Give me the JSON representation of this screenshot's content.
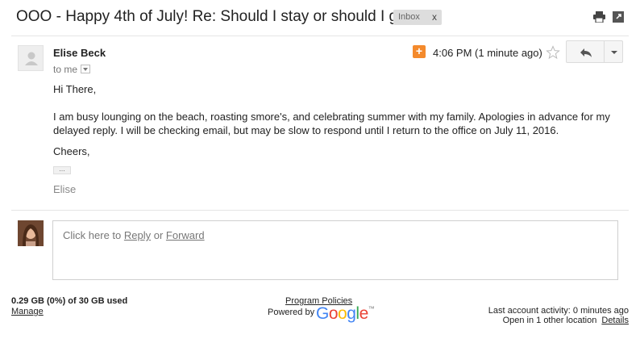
{
  "email": {
    "subject": "OOO - Happy 4th of July! Re: Should I stay or should I go?",
    "label": "Inbox",
    "label_remove": "x",
    "sender": "Elise Beck",
    "to": "to me",
    "time": "4:06 PM (1 minute ago)",
    "plus_badge": "+",
    "greeting": "Hi There,",
    "paragraph": "I am busy lounging on the beach, roasting smore's, and celebrating summer with my family. Apologies in advance for my delayed reply. I will be checking email, but may be slow to respond until I return to the office on July 11, 2016.",
    "closing": "Cheers,",
    "trimmed": "...",
    "signature": "Elise"
  },
  "reply": {
    "prefix": "Click here to ",
    "reply_link": "Reply",
    "or": " or ",
    "forward_link": "Forward"
  },
  "footer": {
    "storage": "0.29 GB (0%) of 30 GB used",
    "manage": "Manage",
    "policies": "Program Policies",
    "powered_by": "Powered by",
    "google_letters": [
      "G",
      "o",
      "o",
      "g",
      "l",
      "e"
    ],
    "google_colors": [
      "#4285f4",
      "#ea4335",
      "#fbbc05",
      "#4285f4",
      "#34a853",
      "#ea4335"
    ],
    "google_tm": "™",
    "last_activity": "Last account activity: 0 minutes ago",
    "open_location": "Open in 1 other location",
    "details": "Details"
  },
  "icons": {
    "print": "print-icon",
    "popout": "popout-icon",
    "star": "star-icon",
    "reply": "reply-icon",
    "more": "chevron-down-icon"
  }
}
